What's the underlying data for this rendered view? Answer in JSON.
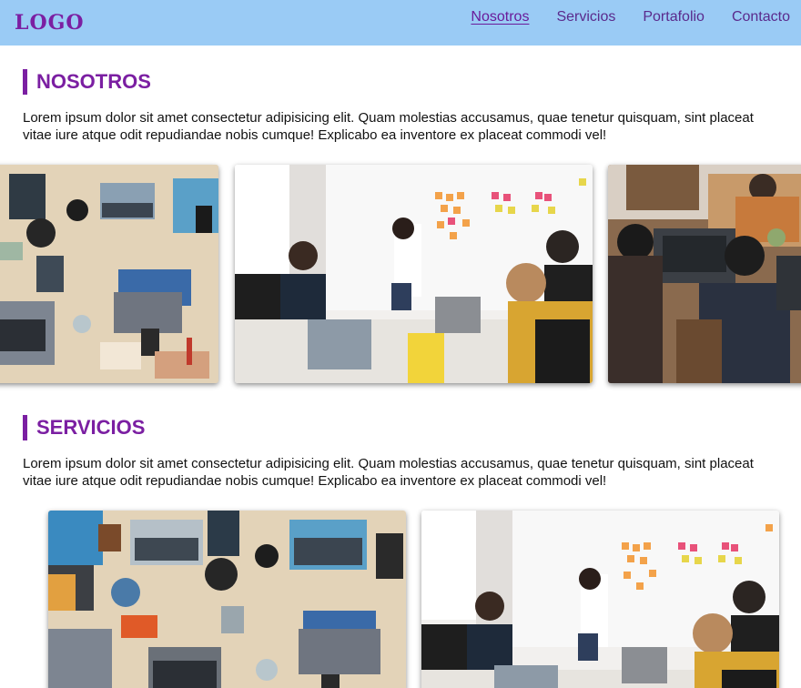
{
  "header": {
    "logo": "LOGO",
    "nav": [
      {
        "label": "Nosotros",
        "active": true
      },
      {
        "label": "Servicios",
        "active": false
      },
      {
        "label": "Portafolio",
        "active": false
      },
      {
        "label": "Contacto",
        "active": false
      }
    ]
  },
  "sections": {
    "nosotros": {
      "title": "NOSOTROS",
      "text": "Lorem ipsum dolor sit amet consectetur adipisicing elit. Quam molestias accusamus, quae tenetur quisquam, sint placeat vitae iure atque odit repudiandae nobis cumque! Explicabo ea inventore ex placeat commodi vel!"
    },
    "servicios": {
      "title": "SERVICIOS",
      "text": "Lorem ipsum dolor sit amet consectetur adipisicing elit. Quam molestias accusamus, quae tenetur quisquam, sint placeat vitae iure atque odit repudiandae nobis cumque! Explicabo ea inventore ex placeat commodi vel!"
    }
  },
  "colors": {
    "header_bg": "#9acbf5",
    "accent": "#7b1fa2"
  }
}
